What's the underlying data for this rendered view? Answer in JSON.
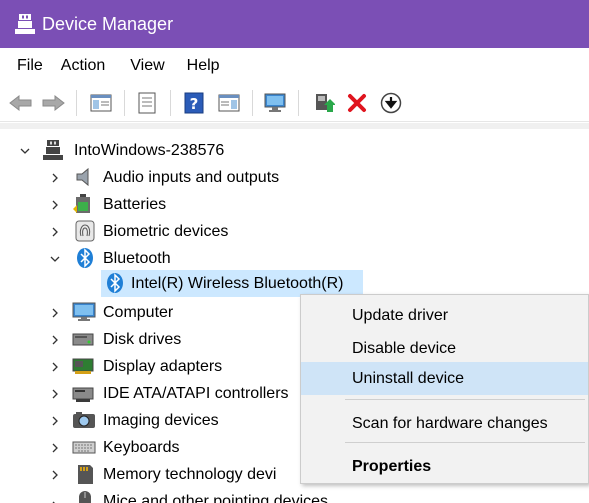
{
  "window": {
    "title": "Device Manager"
  },
  "menu": [
    "File",
    "Action",
    "View",
    "Help"
  ],
  "toolbar": {
    "icons": [
      "back-arrow-icon",
      "forward-arrow-icon",
      "show-hide-tree-icon",
      "properties-sheet-icon",
      "help-icon",
      "action-pane-icon",
      "scan-monitor-icon",
      "update-driver-icon",
      "uninstall-x-icon",
      "disable-down-arrow-icon"
    ]
  },
  "tree": {
    "root": "IntoWindows-238576",
    "categories": [
      {
        "label": "Audio inputs and outputs",
        "icon": "speaker-icon",
        "expanded": false
      },
      {
        "label": "Batteries",
        "icon": "battery-icon",
        "expanded": false
      },
      {
        "label": "Biometric devices",
        "icon": "fingerprint-icon",
        "expanded": false
      },
      {
        "label": "Bluetooth",
        "icon": "bluetooth-icon",
        "expanded": true
      },
      {
        "label": "Computer",
        "icon": "monitor-icon",
        "expanded": false
      },
      {
        "label": "Disk drives",
        "icon": "disk-drive-icon",
        "expanded": false
      },
      {
        "label": "Display adapters",
        "icon": "display-adapter-icon",
        "expanded": false
      },
      {
        "label": "IDE ATA/ATAPI controllers",
        "icon": "ide-controller-icon",
        "expanded": false
      },
      {
        "label": "Imaging devices",
        "icon": "camera-icon",
        "expanded": false
      },
      {
        "label": "Keyboards",
        "icon": "keyboard-icon",
        "expanded": false
      },
      {
        "label": "Memory technology devi",
        "icon": "memory-card-icon",
        "expanded": false
      },
      {
        "label": "Mice and other pointing devices",
        "icon": "mouse-icon",
        "expanded": false
      }
    ],
    "bluetooth_child": "Intel(R) Wireless Bluetooth(R)"
  },
  "context_menu": {
    "items": [
      {
        "label": "Update driver"
      },
      {
        "label": "Disable device"
      },
      {
        "label": "Uninstall device",
        "highlighted": true
      },
      {
        "label": "Scan for hardware changes"
      },
      {
        "label": "Properties",
        "bold": true
      }
    ]
  },
  "colors": {
    "titlebar": "#7b4fb5",
    "selection": "#cce8ff",
    "menu_highlight": "#cfe4f7"
  }
}
